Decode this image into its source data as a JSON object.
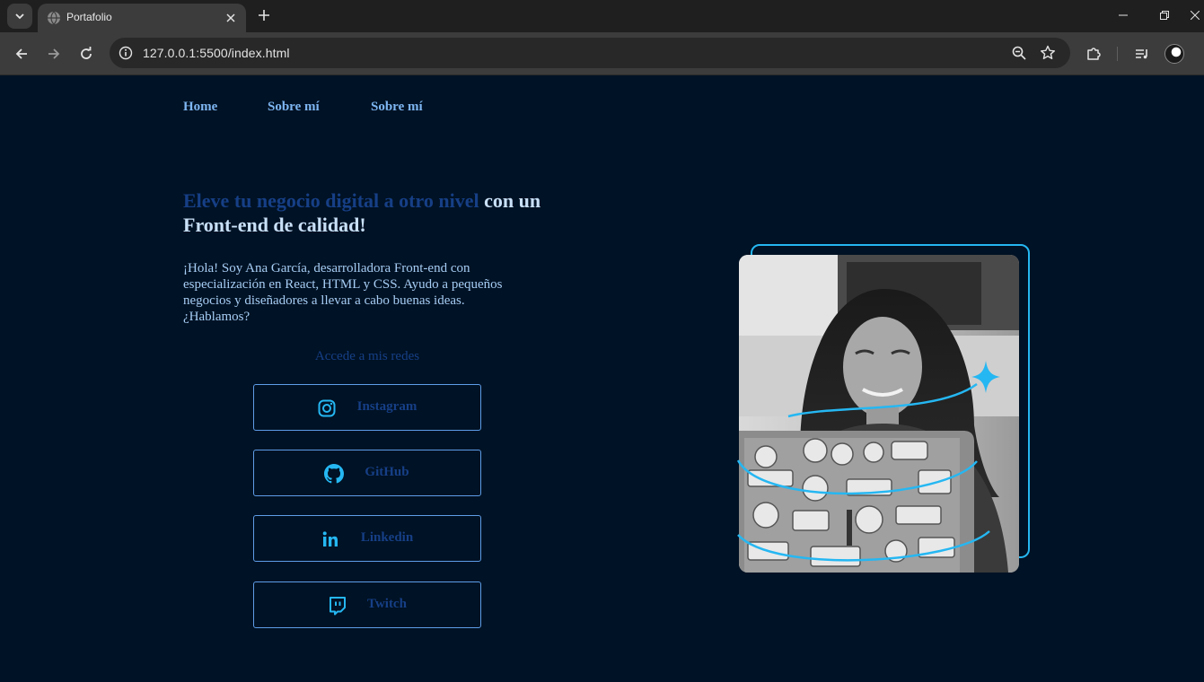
{
  "browser": {
    "tab_title": "Portafolio",
    "url": "127.0.0.1:5500/index.html"
  },
  "nav": {
    "items": [
      "Home",
      "Sobre mí",
      "Sobre mí"
    ]
  },
  "hero": {
    "title_accent": "Eleve tu negocio digital a otro nivel",
    "title_rest": " con un Front-end de calidad!",
    "description": "¡Hola! Soy Ana García, desarrolladora Front-end con especialización en React, HTML y CSS. Ayudo a pequeños negocios y diseñadores a llevar a cabo buenas ideas. ¿Hablamos?"
  },
  "social": {
    "label": "Accede a mis redes",
    "buttons": [
      {
        "label": "Instagram",
        "icon": "instagram-icon"
      },
      {
        "label": "GitHub",
        "icon": "github-icon"
      },
      {
        "label": "Linkedin",
        "icon": "linkedin-icon"
      },
      {
        "label": "Twitch",
        "icon": "twitch-icon"
      }
    ]
  },
  "colors": {
    "page_bg": "#001225",
    "accent_cyan": "#25b7f2",
    "nav_link": "#7eb6f2",
    "accent_dark_blue": "#163f86",
    "button_border": "#5e9de8"
  }
}
